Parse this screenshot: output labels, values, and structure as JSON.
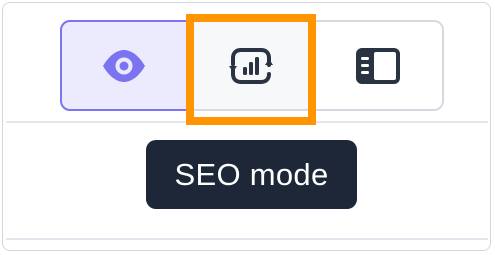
{
  "toolbar": {
    "modes": [
      {
        "name": "preview",
        "icon": "eye-icon",
        "active": true
      },
      {
        "name": "seo",
        "icon": "seo-chart-icon",
        "active": false,
        "highlighted": true
      },
      {
        "name": "sidebar",
        "icon": "sidebar-panel-icon",
        "active": false
      }
    ]
  },
  "tooltip": {
    "text": "SEO mode"
  },
  "colors": {
    "accent": "#7b73f0",
    "active_bg": "#ecebfd",
    "icon_dark": "#2a3342",
    "highlight": "#ff9500",
    "tooltip_bg": "#1d2738"
  }
}
